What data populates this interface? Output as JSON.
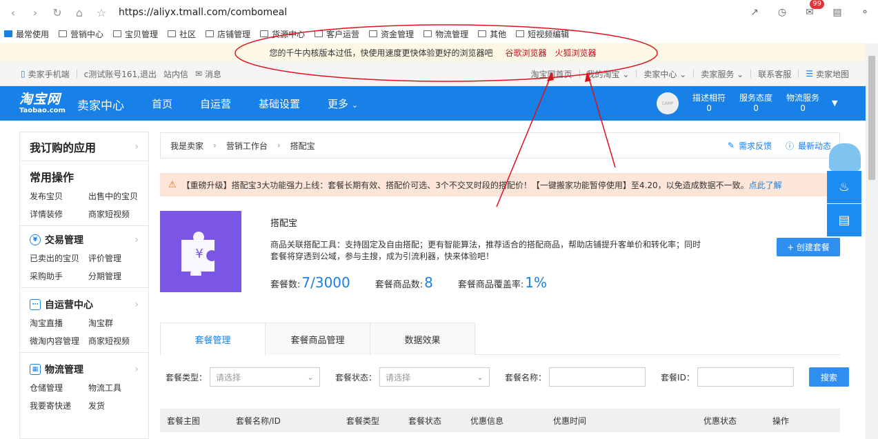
{
  "browser": {
    "url": "https://aliyx.tmall.com/combomeal",
    "mail_badge": "99",
    "bookmarks": [
      "最常使用",
      "营销中心",
      "宝贝管理",
      "社区",
      "店铺管理",
      "货源中心",
      "客户运营",
      "资金管理",
      "物流管理",
      "其他",
      "短视频编辑"
    ]
  },
  "warning": {
    "text": "您的千牛内核版本过低，快使用速度更快体验更好的浏览器吧",
    "chrome": "谷歌浏览器",
    "firefox": "火狐浏览器"
  },
  "topstrip": {
    "mobile": "卖家手机端",
    "account": "c测试账号161,退出",
    "inbox": "站内信",
    "message": "消息",
    "right": [
      "淘宝网首页",
      "我的淘宝",
      "卖家中心",
      "卖家服务",
      "联系客服",
      "卖家地图"
    ]
  },
  "header": {
    "logo_cn": "淘宝网",
    "logo_en": "Taobao.com",
    "title": "卖家中心",
    "nav": [
      "首页",
      "自运营",
      "基础设置",
      "更多"
    ],
    "avatar": "CAMP",
    "scores": [
      {
        "label": "描述相符",
        "value": "0"
      },
      {
        "label": "服务态度",
        "value": "0"
      },
      {
        "label": "物流服务",
        "value": "0"
      }
    ]
  },
  "sidebar": {
    "top": "我订购的应用",
    "common": {
      "title": "常用操作",
      "items": [
        "发布宝贝",
        "出售中的宝贝",
        "详情装修",
        "商家短视频"
      ]
    },
    "sections": [
      {
        "title": "交易管理",
        "items": [
          "已卖出的宝贝",
          "评价管理",
          "采购助手",
          "分期管理"
        ]
      },
      {
        "title": "自运营中心",
        "items": [
          "淘宝直播",
          "淘宝群",
          "微淘内容管理",
          "商家短视频"
        ]
      },
      {
        "title": "物流管理",
        "items": [
          "仓储管理",
          "物流工具",
          "我要寄快递",
          "发货"
        ]
      }
    ]
  },
  "breadcrumb": {
    "items": [
      "我是卖家",
      "营销工作台",
      "搭配宝"
    ],
    "feedback": "需求反馈",
    "news": "最新动态"
  },
  "notice": {
    "text": "【重磅升级】搭配宝3大功能强力上线：套餐长期有效、搭配价可选、3个不交叉时段的搭配价！【一键搬家功能暂停使用】至4.20，以免造成数据不一致。",
    "link": "点此了解"
  },
  "product": {
    "title": "搭配宝",
    "desc1": "商品关联搭配工具：支持固定及自由搭配；更有智能算法，推荐适合的搭配商品，帮助店铺提升客单价和转化率；同时",
    "desc2": "套餐将穿透到公域，参与主搜，成为引流利器，快来体验吧！",
    "stats": [
      {
        "label": "套餐数:",
        "value": "7/3000"
      },
      {
        "label": "套餐商品数:",
        "value": "8"
      },
      {
        "label": "套餐商品覆盖率:",
        "value": "1%"
      }
    ],
    "create": "+ 创建套餐"
  },
  "tabs": [
    "套餐管理",
    "套餐商品管理",
    "数据效果"
  ],
  "filters": {
    "type_label": "套餐类型：",
    "type_placeholder": "请选择",
    "status_label": "套餐状态：",
    "status_placeholder": "请选择",
    "name_label": "套餐名称：",
    "id_label": "套餐ID：",
    "search": "搜索"
  },
  "table": {
    "headers": [
      "套餐主图",
      "套餐名称/ID",
      "套餐类型",
      "套餐状态",
      "优惠信息",
      "优惠时间",
      "优惠状态",
      "操作"
    ]
  },
  "colors": {
    "brand_blue": "#1781e7",
    "annotation_red": "#e0101a",
    "warning_link": "#c0121d"
  }
}
